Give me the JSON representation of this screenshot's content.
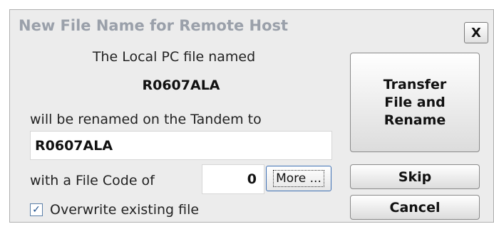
{
  "dialog": {
    "title": "New File Name for Remote Host",
    "close_label": "X"
  },
  "body": {
    "line1": "The Local PC file named",
    "local_file_name": "R0607ALA",
    "line2": "will be renamed on the Tandem to",
    "remote_file_name": "R0607ALA",
    "line3": "with a File Code of",
    "file_code": "0",
    "more_label": "More ...",
    "overwrite_label": "Overwrite existing file",
    "overwrite_checked": true
  },
  "buttons": {
    "transfer_label": "Transfer\nFile and\nRename",
    "skip_label": "Skip",
    "cancel_label": "Cancel"
  }
}
